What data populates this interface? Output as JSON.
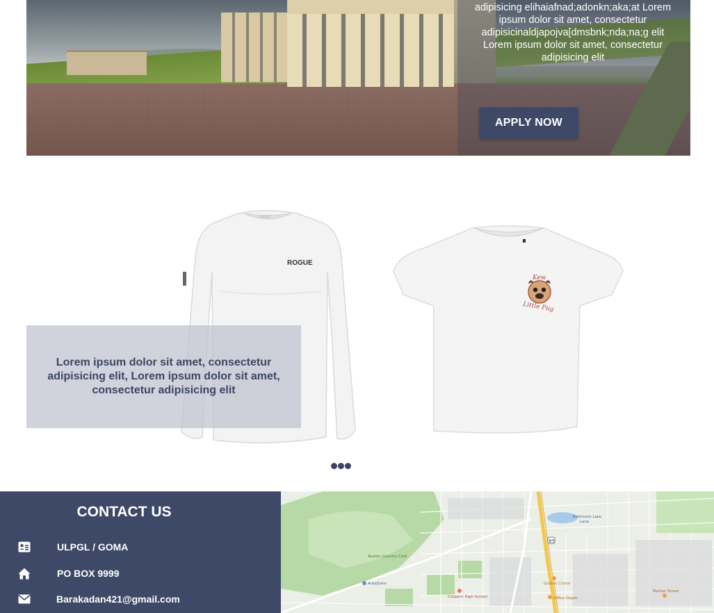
{
  "hero": {
    "text": "adipisicing elihaiafnad;adonkn;aka;at Lorem ipsum dolor sit amet, consectetur adipisicinaldjapojva[dmsbnk;nda;na;g elit Lorem ipsum dolor sit amet, consectetur adipisicing elit",
    "button_label": "APPLY NOW"
  },
  "carousel": {
    "caption": "Lorem ipsum dolor sit amet, consectetur adipisicing elit, Lorem ipsum dolor sit amet, consectetur adipisicing elit",
    "long_sleeve_brand": "ROGUE",
    "tee_logo_line1": "Kew",
    "tee_logo_line2": "Little Pug",
    "dot_count": 3
  },
  "contact": {
    "title": "CONTACT US",
    "items": [
      {
        "icon": "id-card-icon",
        "value": "ULPGL / GOMA"
      },
      {
        "icon": "home-icon",
        "value": "PO BOX 9999"
      },
      {
        "icon": "envelope-icon",
        "value": "Barakadan421@gmail.com"
      }
    ]
  },
  "map": {
    "labels": [
      "Avalon Country Club",
      "Lane",
      "Golden Corral",
      "Coopers High School",
      "Office Depot",
      "Market Street",
      "Baltimore Lake",
      "AutoZone",
      "83"
    ]
  },
  "colors": {
    "primary": "#3d4966",
    "caption_text": "#3b4563",
    "caption_bg": "#bec2ce"
  }
}
